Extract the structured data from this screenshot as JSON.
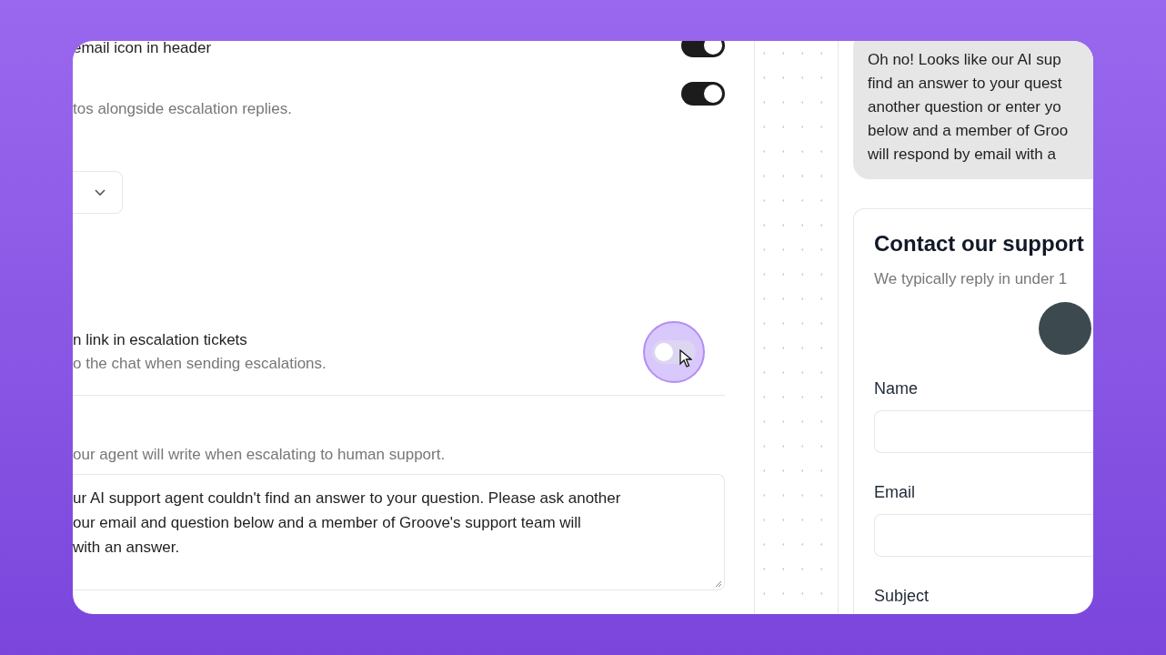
{
  "settings": {
    "rows": [
      {
        "kind": "toggle",
        "title": "email icon in header",
        "on": true
      },
      {
        "kind": "toggle",
        "description": "tos alongside escalation replies.",
        "on": true
      },
      {
        "kind": "dropdown"
      },
      {
        "kind": "toggle",
        "title": "n link in escalation tickets",
        "description": "o the chat when sending escalations.",
        "on": false,
        "focused": true
      },
      {
        "kind": "textarea",
        "description": "our agent will write when escalating to human support.",
        "value_lines": [
          "ur AI support agent couldn't find an answer to your question. Please ask another",
          "our email and question below and a member of Groove's support team will",
          "with an answer."
        ]
      }
    ]
  },
  "preview": {
    "message_lines": [
      "Oh no! Looks like our AI sup",
      "find an answer to your quest",
      "another question or enter yo",
      "below and a member of Groo",
      "will respond by email with a"
    ],
    "contact_card": {
      "title": "Contact our support",
      "subtitle": "We typically reply in under 1",
      "fields": [
        {
          "label": "Name"
        },
        {
          "label": "Email"
        },
        {
          "label": "Subject"
        }
      ]
    }
  }
}
